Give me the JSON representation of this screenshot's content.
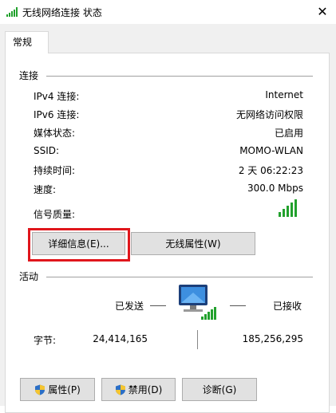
{
  "window": {
    "title": "无线网络连接 状态",
    "close_glyph": "✕"
  },
  "tab": {
    "label": "常规"
  },
  "connection": {
    "group_label": "连接",
    "rows": [
      {
        "label": "IPv4 连接:",
        "value": "Internet"
      },
      {
        "label": "IPv6 连接:",
        "value": "无网络访问权限"
      },
      {
        "label": "媒体状态:",
        "value": "已启用"
      },
      {
        "label": "SSID:",
        "value": "MOMO-WLAN"
      },
      {
        "label": "持续时间:",
        "value": "2 天 06:22:23"
      },
      {
        "label": "速度:",
        "value": "300.0 Mbps"
      }
    ],
    "signal_label": "信号质量:",
    "signal_bars": 5,
    "signal_color": "#22a12d"
  },
  "buttons": {
    "details": "详细信息(E)...",
    "wireless_properties": "无线属性(W)"
  },
  "activity": {
    "group_label": "活动",
    "sent_label": "已发送",
    "received_label": "已接收",
    "bytes_label": "字节:",
    "bytes_sent": "24,414,165",
    "bytes_received": "185,256,295"
  },
  "footer": {
    "properties": "属性(P)",
    "disable": "禁用(D)",
    "diagnose": "诊断(G)"
  },
  "colors": {
    "highlight": "#e0161c",
    "shield_blue": "#2b6fc7",
    "shield_yellow": "#f5c531"
  }
}
